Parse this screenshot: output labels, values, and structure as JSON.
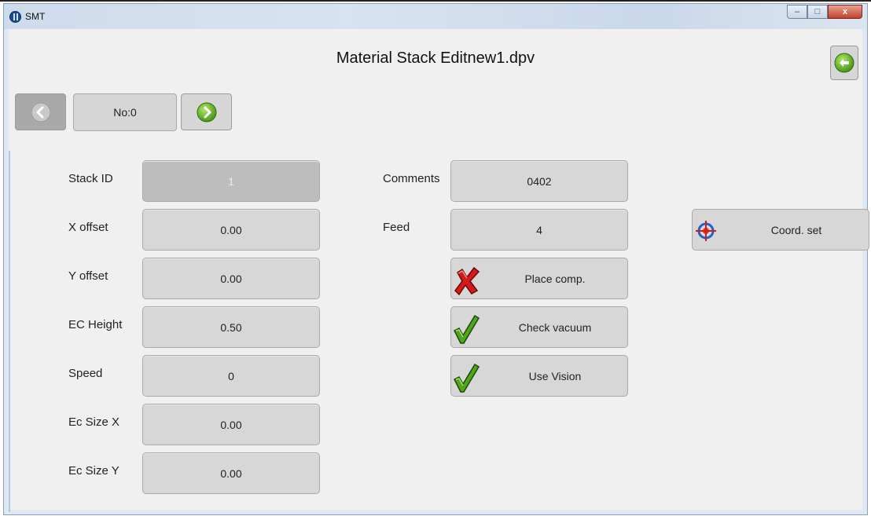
{
  "window": {
    "app_title": "SMT",
    "controls": {
      "minimize": "–",
      "maximize": "□",
      "close": "x"
    }
  },
  "header": {
    "title": "Material Stack Editnew1.dpv",
    "back_icon": "arrow-left-circle-icon"
  },
  "navigator": {
    "prev_icon": "chevron-left-circle-icon",
    "next_icon": "chevron-right-circle-icon",
    "number_label": "No:0"
  },
  "form": {
    "fields": [
      {
        "label": "Stack ID",
        "value": "1",
        "disabled": true
      },
      {
        "label": "X offset",
        "value": "0.00"
      },
      {
        "label": "Y offset",
        "value": "0.00"
      },
      {
        "label": "EC Height",
        "value": "0.50"
      },
      {
        "label": "Speed",
        "value": "0"
      },
      {
        "label": "Ec Size X",
        "value": "0.00"
      },
      {
        "label": "Ec Size Y",
        "value": "0.00"
      }
    ],
    "comments": {
      "label": "Comments",
      "value": "0402"
    },
    "feed": {
      "label": "Feed",
      "value": "4"
    },
    "toggles": [
      {
        "label": "Place comp.",
        "state": false,
        "icon": "cross-icon"
      },
      {
        "label": "Check vacuum",
        "state": true,
        "icon": "checkmark-icon"
      },
      {
        "label": "Use Vision",
        "state": true,
        "icon": "checkmark-icon"
      }
    ],
    "coord_button": {
      "label": "Coord. set",
      "icon": "crosshair-target-icon"
    }
  },
  "colors": {
    "field_bg": "#d7d7d7",
    "disabled_bg": "#bdbdbd",
    "green": "#4fa51c",
    "red": "#d31b1b"
  }
}
